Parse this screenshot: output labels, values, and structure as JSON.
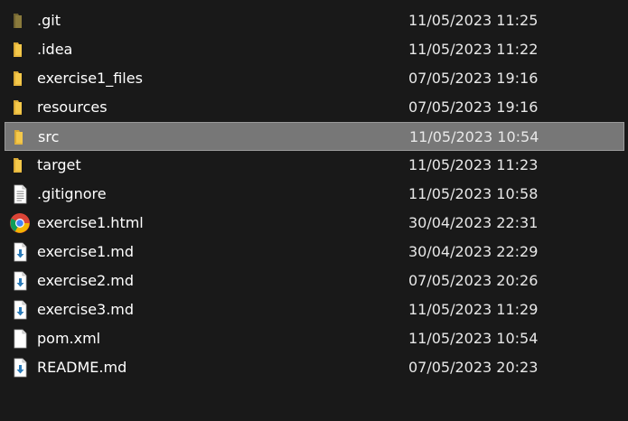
{
  "colors": {
    "background": "#191919",
    "selected_row": "#777777",
    "folder_yellow": "#f4c84a",
    "git_folder": "#8a7a3c"
  },
  "files": [
    {
      "name": ".git",
      "date": "11/05/2023 11:25",
      "icon": "folder-git-icon",
      "selected": false
    },
    {
      "name": ".idea",
      "date": "11/05/2023 11:22",
      "icon": "folder-icon",
      "selected": false
    },
    {
      "name": "exercise1_files",
      "date": "07/05/2023 19:16",
      "icon": "folder-icon",
      "selected": false
    },
    {
      "name": "resources",
      "date": "07/05/2023 19:16",
      "icon": "folder-icon",
      "selected": false
    },
    {
      "name": "src",
      "date": "11/05/2023 10:54",
      "icon": "folder-icon",
      "selected": true
    },
    {
      "name": "target",
      "date": "11/05/2023 11:23",
      "icon": "folder-icon",
      "selected": false
    },
    {
      "name": ".gitignore",
      "date": "11/05/2023 10:58",
      "icon": "text-file-icon",
      "selected": false
    },
    {
      "name": "exercise1.html",
      "date": "30/04/2023 22:31",
      "icon": "chrome-icon",
      "selected": false
    },
    {
      "name": "exercise1.md",
      "date": "30/04/2023 22:29",
      "icon": "markdown-file-icon",
      "selected": false
    },
    {
      "name": "exercise2.md",
      "date": "07/05/2023 20:26",
      "icon": "markdown-file-icon",
      "selected": false
    },
    {
      "name": "exercise3.md",
      "date": "11/05/2023 11:29",
      "icon": "markdown-file-icon",
      "selected": false
    },
    {
      "name": "pom.xml",
      "date": "11/05/2023 10:54",
      "icon": "blank-file-icon",
      "selected": false
    },
    {
      "name": "README.md",
      "date": "07/05/2023 20:23",
      "icon": "markdown-file-icon",
      "selected": false
    }
  ]
}
